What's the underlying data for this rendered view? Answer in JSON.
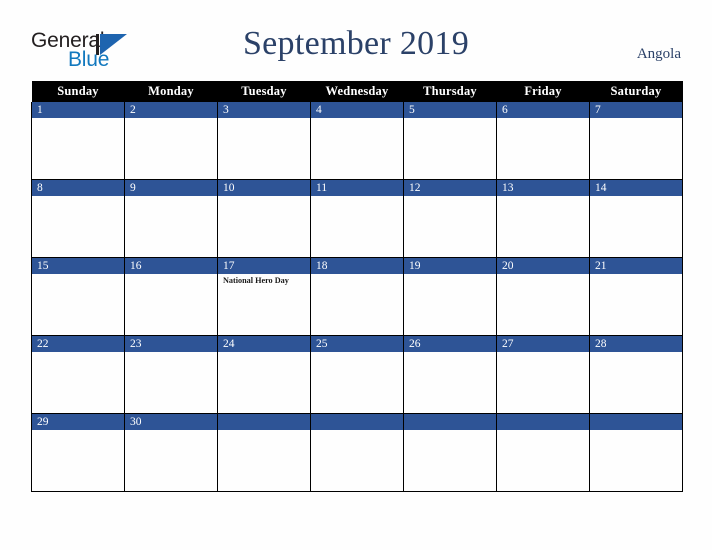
{
  "brand": {
    "name_part1": "General",
    "name_part2": "Blue",
    "mark": "triangle-logo-icon",
    "color_dark": "#231F20",
    "color_blue": "#1278BE",
    "color_mark": "#1E64AF"
  },
  "header": {
    "title": "September 2019",
    "country": "Angola",
    "title_color": "#2B4168"
  },
  "calendar": {
    "weekday_headers": [
      "Sunday",
      "Monday",
      "Tuesday",
      "Wednesday",
      "Thursday",
      "Friday",
      "Saturday"
    ],
    "header_background": "#000000",
    "daynum_background": "#2E5496",
    "weeks": [
      [
        {
          "day": "1",
          "events": []
        },
        {
          "day": "2",
          "events": []
        },
        {
          "day": "3",
          "events": []
        },
        {
          "day": "4",
          "events": []
        },
        {
          "day": "5",
          "events": []
        },
        {
          "day": "6",
          "events": []
        },
        {
          "day": "7",
          "events": []
        }
      ],
      [
        {
          "day": "8",
          "events": []
        },
        {
          "day": "9",
          "events": []
        },
        {
          "day": "10",
          "events": []
        },
        {
          "day": "11",
          "events": []
        },
        {
          "day": "12",
          "events": []
        },
        {
          "day": "13",
          "events": []
        },
        {
          "day": "14",
          "events": []
        }
      ],
      [
        {
          "day": "15",
          "events": []
        },
        {
          "day": "16",
          "events": []
        },
        {
          "day": "17",
          "events": [
            "National Hero Day"
          ]
        },
        {
          "day": "18",
          "events": []
        },
        {
          "day": "19",
          "events": []
        },
        {
          "day": "20",
          "events": []
        },
        {
          "day": "21",
          "events": []
        }
      ],
      [
        {
          "day": "22",
          "events": []
        },
        {
          "day": "23",
          "events": []
        },
        {
          "day": "24",
          "events": []
        },
        {
          "day": "25",
          "events": []
        },
        {
          "day": "26",
          "events": []
        },
        {
          "day": "27",
          "events": []
        },
        {
          "day": "28",
          "events": []
        }
      ],
      [
        {
          "day": "29",
          "events": []
        },
        {
          "day": "30",
          "events": []
        },
        {
          "day": "",
          "events": []
        },
        {
          "day": "",
          "events": []
        },
        {
          "day": "",
          "events": []
        },
        {
          "day": "",
          "events": []
        },
        {
          "day": "",
          "events": []
        }
      ]
    ]
  }
}
